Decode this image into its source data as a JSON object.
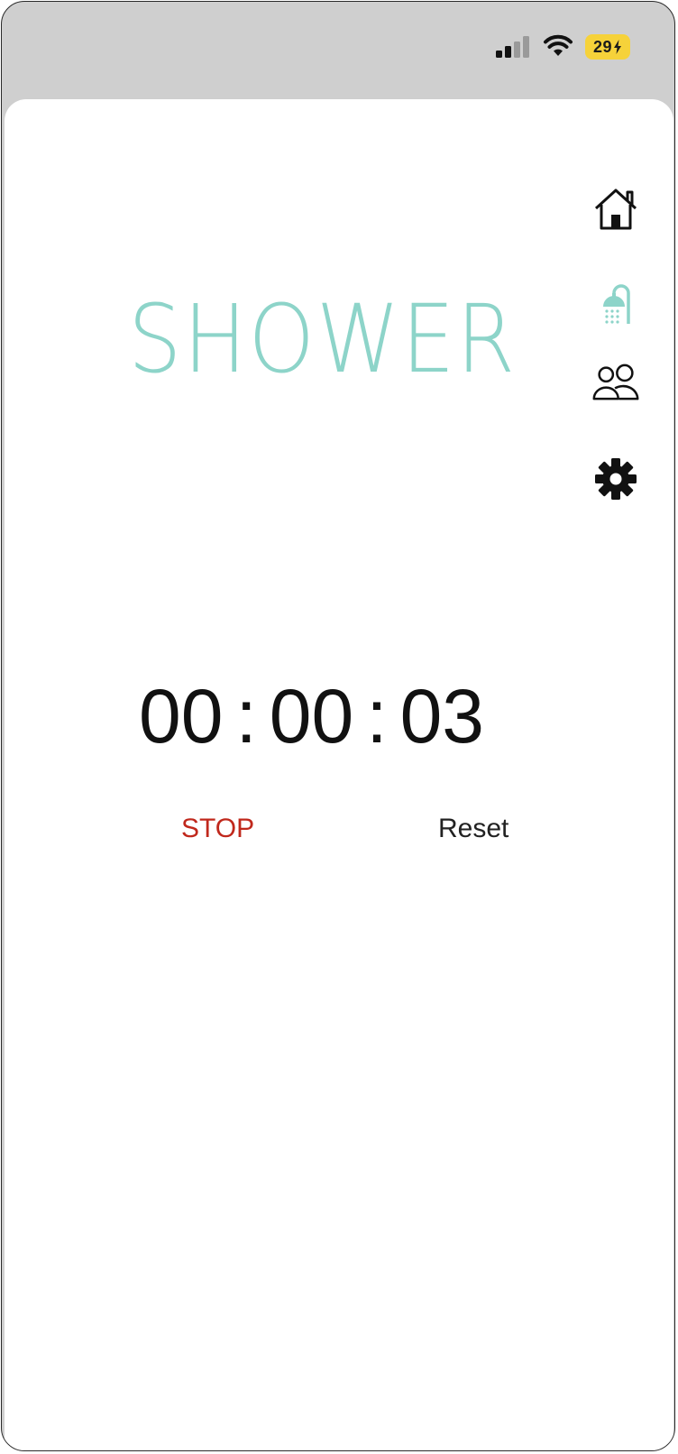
{
  "status_bar": {
    "battery_level": "29",
    "battery_color": "#f6d23a",
    "signal_icon": "signal-bars-icon",
    "wifi_icon": "wifi-icon",
    "charging_icon": "bolt-icon"
  },
  "page": {
    "title": "SHOWER",
    "title_color": "#8dd4c9"
  },
  "nav": {
    "items": [
      {
        "icon": "home-icon",
        "active": false
      },
      {
        "icon": "shower-icon",
        "active": true
      },
      {
        "icon": "users-icon",
        "active": false
      },
      {
        "icon": "gear-icon",
        "active": false
      }
    ],
    "active_color": "#8dd4c9"
  },
  "timer": {
    "hours": "00",
    "minutes": "00",
    "seconds": "03",
    "separator": ":"
  },
  "controls": {
    "stop_label": "STOP",
    "stop_color": "#c0281c",
    "reset_label": "Reset"
  }
}
